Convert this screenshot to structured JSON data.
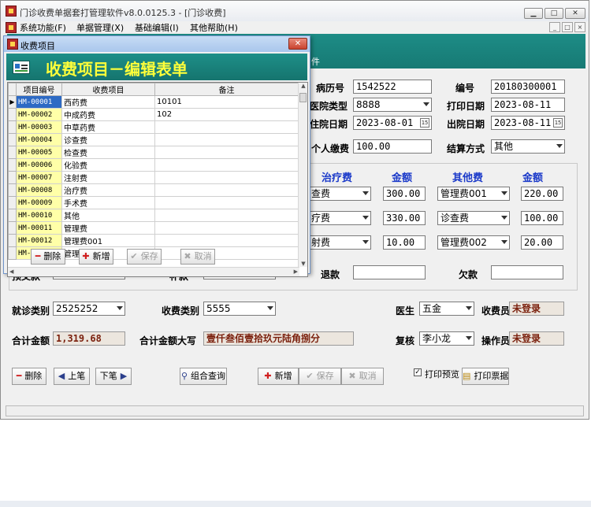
{
  "window": {
    "title": "门诊收费单据套打管理软件v8.0.0125.3 - [门诊收费]",
    "controls": {
      "minimize": "▁",
      "maximize": "□",
      "close": "✕"
    }
  },
  "menubar": {
    "items": [
      "系统功能(F)",
      "单据管理(X)",
      "基础编辑(I)",
      "其他帮助(H)"
    ],
    "mdi_controls": [
      "_",
      "□",
      "×"
    ]
  },
  "banner_fragment": "件",
  "form": {
    "record_no_label": "病历号",
    "record_no": "1542522",
    "number_label": "编号",
    "number": "20180300001",
    "hospital_type_label": "医院类型",
    "hospital_type": "8888",
    "print_date_label": "打印日期",
    "print_date": "2023-08-11",
    "admit_date_label": "住院日期",
    "admit_date": "2023-08-01",
    "discharge_date_label": "出院日期",
    "discharge_date": "2023-08-11",
    "self_pay_label": "个人缴费",
    "self_pay": "100.00",
    "settlement_label": "结算方式",
    "settlement": "其他",
    "refund_label": "退款",
    "refund": "",
    "arrears_label": "欠款",
    "arrears": "",
    "partial_left_label_1": "预交款",
    "partial_left_label_2": "补款"
  },
  "fees": {
    "col_treatment": "治疗费",
    "col_amount": "金额",
    "col_other": "其他费",
    "col_amount2": "金额",
    "rows": [
      {
        "treatment": "查费",
        "amount": "300.00",
        "other": "管理费001",
        "other_amount": "220.00"
      },
      {
        "treatment": "疗费",
        "amount": "330.00",
        "other": "诊查费",
        "other_amount": "100.00"
      },
      {
        "treatment": "射费",
        "amount": "10.00",
        "other": "管理费002",
        "other_amount": "20.00"
      }
    ]
  },
  "bottom": {
    "visit_type_label": "就诊类别",
    "visit_type": "2525252",
    "charge_type_label": "收费类别",
    "charge_type": "5555",
    "doctor_label": "医生",
    "doctor": "五金",
    "cashier_label": "收费员",
    "cashier": "未登录",
    "total_label": "合计金额",
    "total": "1,319.68",
    "total_cn_label": "合计金额大写",
    "total_cn": "壹仟叁佰壹拾玖元陆角捌分",
    "reviewer_label": "复核",
    "reviewer": "李小龙",
    "operator_label": "操作员",
    "operator": "未登录"
  },
  "buttons": {
    "delete": "删除",
    "prev": "上笔",
    "next": "下笔",
    "combo_query": "组合查询",
    "add": "新增",
    "save": "保存",
    "cancel": "取消",
    "print_preview": "打印预览",
    "print_receipt": "打印票据"
  },
  "dialog": {
    "title": "收费项目",
    "heading": "收费项目－编辑表单",
    "columns": [
      "项目编号",
      "收费项目",
      "备注"
    ],
    "rows": [
      {
        "code": "HM-00001",
        "name": "西药费",
        "note": "10101"
      },
      {
        "code": "HM-00002",
        "name": "中成药费",
        "note": "102"
      },
      {
        "code": "HM-00003",
        "name": "中草药费",
        "note": ""
      },
      {
        "code": "HM-00004",
        "name": "诊查费",
        "note": ""
      },
      {
        "code": "HM-00005",
        "name": "检查费",
        "note": ""
      },
      {
        "code": "HM-00006",
        "name": "化验费",
        "note": ""
      },
      {
        "code": "HM-00007",
        "name": "注射费",
        "note": ""
      },
      {
        "code": "HM-00008",
        "name": "治疗费",
        "note": ""
      },
      {
        "code": "HM-00009",
        "name": "手术费",
        "note": ""
      },
      {
        "code": "HM-00010",
        "name": "其他",
        "note": ""
      },
      {
        "code": "HM-00011",
        "name": "管理费",
        "note": ""
      },
      {
        "code": "HM-00012",
        "name": "管理费001",
        "note": ""
      },
      {
        "code": "HM-00013",
        "name": "管理费002",
        "note": ""
      }
    ],
    "buttons": {
      "delete": "删除",
      "add": "新增",
      "save": "保存",
      "cancel": "取消"
    }
  },
  "colors": {
    "banner": "#1a837d",
    "heading_yellow": "#ffff3a",
    "label_blue": "#1a39c9",
    "readonly_text": "#7a1f0c"
  }
}
